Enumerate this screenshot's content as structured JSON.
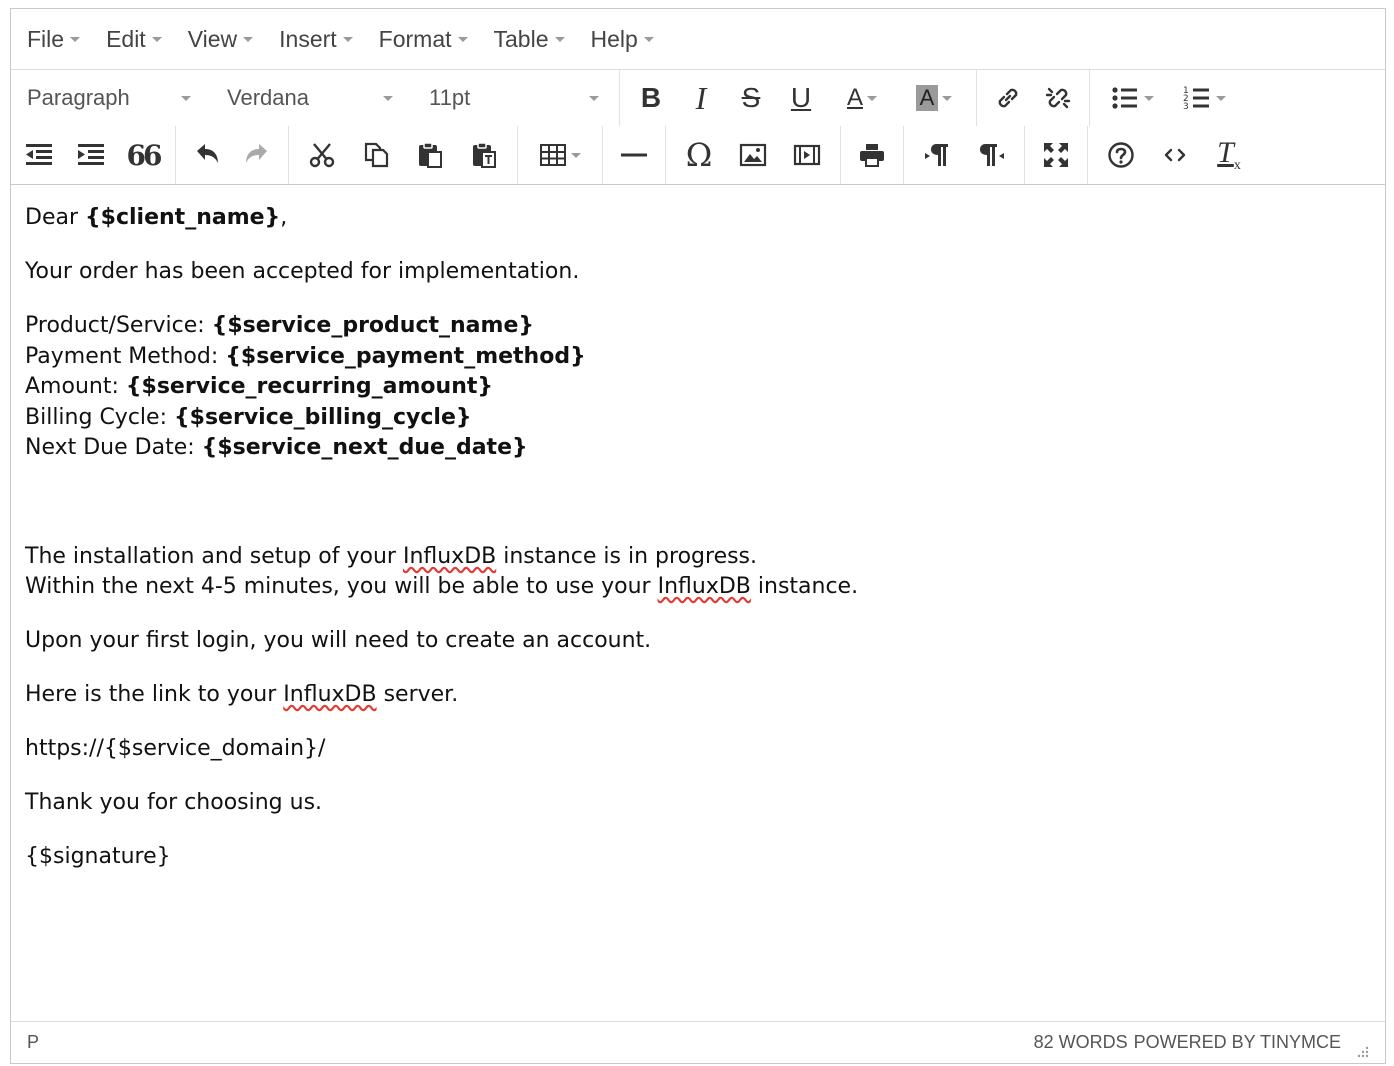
{
  "menubar": {
    "items": [
      "File",
      "Edit",
      "View",
      "Insert",
      "Format",
      "Table",
      "Help"
    ]
  },
  "toolbar": {
    "block_format": "Paragraph",
    "font_family": "Verdana",
    "font_size": "11pt",
    "bold_label": "B",
    "italic_label": "I",
    "strike_label": "S",
    "underline_label": "U",
    "text_color_label": "A",
    "bg_color_label": "A",
    "quote_label": "66",
    "omega_label": "Ω",
    "nbsp_label": "¶",
    "clear_format_label": "Tx"
  },
  "content": {
    "greeting_prefix": "Dear ",
    "client_name": "{$client_name}",
    "greeting_suffix": ",",
    "line_accepted": "Your order has been accepted for implementation.",
    "details": [
      {
        "label": "Product/Service: ",
        "value": "{$service_product_name}"
      },
      {
        "label": "Payment Method: ",
        "value": "{$service_payment_method}"
      },
      {
        "label": "Amount: ",
        "value": "{$service_recurring_amount}"
      },
      {
        "label": "Billing Cycle: ",
        "value": "{$service_billing_cycle}"
      },
      {
        "label": "Next Due Date: ",
        "value": "{$service_next_due_date}"
      }
    ],
    "install_1a": "The installation and setup of your ",
    "install_1b": "InfluxDB",
    "install_1c": " instance is in progress.",
    "install_2a": "Within the next 4-5 minutes, you will be able to use your ",
    "install_2b": "InfluxDB",
    "install_2c": " instance.",
    "first_login": "Upon your first login, you will need to create an account.",
    "link_a": "Here is the link to your ",
    "link_b": "InfluxDB",
    "link_c": " server.",
    "url": "https://{$service_domain}/",
    "thanks": "Thank you for choosing us.",
    "signature": "{$signature}"
  },
  "statusbar": {
    "path": "P",
    "word_count": "82 WORDS",
    "powered_by": "POWERED BY TINYMCE"
  }
}
